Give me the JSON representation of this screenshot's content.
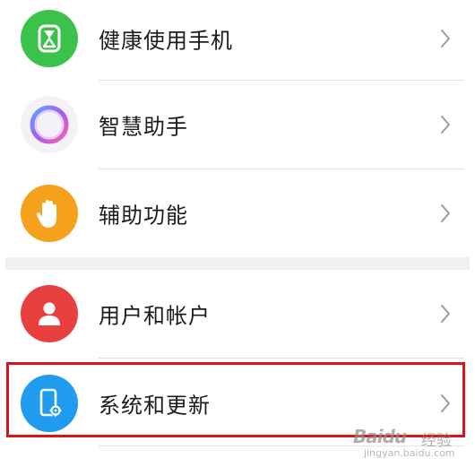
{
  "settings": {
    "items": [
      {
        "label": "健康使用手机",
        "icon": "hourglass-icon",
        "color": "#3cc24a"
      },
      {
        "label": "智慧助手",
        "icon": "assistant-ring-icon",
        "color": "#a24fe0"
      },
      {
        "label": "辅助功能",
        "icon": "hand-icon",
        "color": "#f5a11b"
      },
      {
        "label": "用户和帐户",
        "icon": "user-icon",
        "color": "#e8403e"
      },
      {
        "label": "系统和更新",
        "icon": "phone-gear-icon",
        "color": "#1f9bf0"
      }
    ],
    "highlight_color": "#d9141c"
  },
  "watermark": {
    "logo": "Baidu",
    "cn": "经验",
    "url": "jingyan.baidu.com"
  }
}
